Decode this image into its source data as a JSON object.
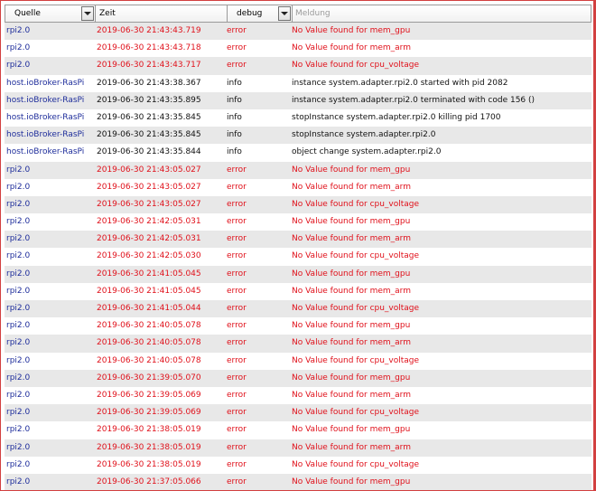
{
  "header": {
    "col_source": "Quelle",
    "col_time": "Zeit",
    "col_severity": "debug",
    "col_message_placeholder": "Meldung"
  },
  "colors": {
    "error": "#e0101a",
    "source": "#1e2d9b",
    "info": "#111111"
  },
  "rows": [
    {
      "source": "rpi2.0",
      "time": "2019-06-30 21:43:43.719",
      "severity": "error",
      "message": "No Value found for mem_gpu"
    },
    {
      "source": "rpi2.0",
      "time": "2019-06-30 21:43:43.718",
      "severity": "error",
      "message": "No Value found for mem_arm"
    },
    {
      "source": "rpi2.0",
      "time": "2019-06-30 21:43:43.717",
      "severity": "error",
      "message": "No Value found for cpu_voltage"
    },
    {
      "source": "host.ioBroker-RasPi",
      "time": "2019-06-30 21:43:38.367",
      "severity": "info",
      "message": "instance system.adapter.rpi2.0 started with pid 2082"
    },
    {
      "source": "host.ioBroker-RasPi",
      "time": "2019-06-30 21:43:35.895",
      "severity": "info",
      "message": "instance system.adapter.rpi2.0 terminated with code 156 ()"
    },
    {
      "source": "host.ioBroker-RasPi",
      "time": "2019-06-30 21:43:35.845",
      "severity": "info",
      "message": "stopInstance system.adapter.rpi2.0 killing pid 1700"
    },
    {
      "source": "host.ioBroker-RasPi",
      "time": "2019-06-30 21:43:35.845",
      "severity": "info",
      "message": "stopInstance system.adapter.rpi2.0"
    },
    {
      "source": "host.ioBroker-RasPi",
      "time": "2019-06-30 21:43:35.844",
      "severity": "info",
      "message": "object change system.adapter.rpi2.0"
    },
    {
      "source": "rpi2.0",
      "time": "2019-06-30 21:43:05.027",
      "severity": "error",
      "message": "No Value found for mem_gpu"
    },
    {
      "source": "rpi2.0",
      "time": "2019-06-30 21:43:05.027",
      "severity": "error",
      "message": "No Value found for mem_arm"
    },
    {
      "source": "rpi2.0",
      "time": "2019-06-30 21:43:05.027",
      "severity": "error",
      "message": "No Value found for cpu_voltage"
    },
    {
      "source": "rpi2.0",
      "time": "2019-06-30 21:42:05.031",
      "severity": "error",
      "message": "No Value found for mem_gpu"
    },
    {
      "source": "rpi2.0",
      "time": "2019-06-30 21:42:05.031",
      "severity": "error",
      "message": "No Value found for mem_arm"
    },
    {
      "source": "rpi2.0",
      "time": "2019-06-30 21:42:05.030",
      "severity": "error",
      "message": "No Value found for cpu_voltage"
    },
    {
      "source": "rpi2.0",
      "time": "2019-06-30 21:41:05.045",
      "severity": "error",
      "message": "No Value found for mem_gpu"
    },
    {
      "source": "rpi2.0",
      "time": "2019-06-30 21:41:05.045",
      "severity": "error",
      "message": "No Value found for mem_arm"
    },
    {
      "source": "rpi2.0",
      "time": "2019-06-30 21:41:05.044",
      "severity": "error",
      "message": "No Value found for cpu_voltage"
    },
    {
      "source": "rpi2.0",
      "time": "2019-06-30 21:40:05.078",
      "severity": "error",
      "message": "No Value found for mem_gpu"
    },
    {
      "source": "rpi2.0",
      "time": "2019-06-30 21:40:05.078",
      "severity": "error",
      "message": "No Value found for mem_arm"
    },
    {
      "source": "rpi2.0",
      "time": "2019-06-30 21:40:05.078",
      "severity": "error",
      "message": "No Value found for cpu_voltage"
    },
    {
      "source": "rpi2.0",
      "time": "2019-06-30 21:39:05.070",
      "severity": "error",
      "message": "No Value found for mem_gpu"
    },
    {
      "source": "rpi2.0",
      "time": "2019-06-30 21:39:05.069",
      "severity": "error",
      "message": "No Value found for mem_arm"
    },
    {
      "source": "rpi2.0",
      "time": "2019-06-30 21:39:05.069",
      "severity": "error",
      "message": "No Value found for cpu_voltage"
    },
    {
      "source": "rpi2.0",
      "time": "2019-06-30 21:38:05.019",
      "severity": "error",
      "message": "No Value found for mem_gpu"
    },
    {
      "source": "rpi2.0",
      "time": "2019-06-30 21:38:05.019",
      "severity": "error",
      "message": "No Value found for mem_arm"
    },
    {
      "source": "rpi2.0",
      "time": "2019-06-30 21:38:05.019",
      "severity": "error",
      "message": "No Value found for cpu_voltage"
    },
    {
      "source": "rpi2.0",
      "time": "2019-06-30 21:37:05.066",
      "severity": "error",
      "message": "No Value found for mem_gpu"
    }
  ]
}
